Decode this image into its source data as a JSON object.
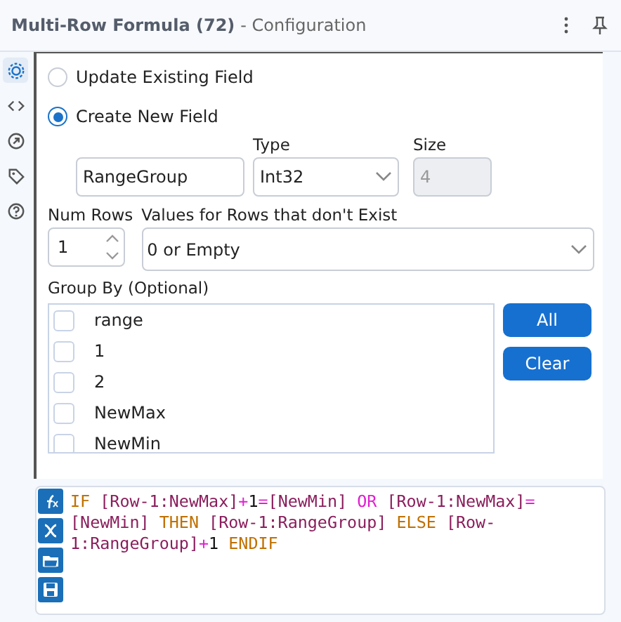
{
  "header": {
    "title": "Multi-Row Formula (72)",
    "subtitle": "- Configuration"
  },
  "side_tabs": [
    {
      "kind": "gear",
      "selected": true
    },
    {
      "kind": "code",
      "selected": false
    },
    {
      "kind": "arrow",
      "selected": false
    },
    {
      "kind": "tag",
      "selected": false
    },
    {
      "kind": "help",
      "selected": false
    }
  ],
  "mode_options": [
    {
      "label": "Update Existing Field",
      "selected": false
    },
    {
      "label": "Create New  Field",
      "selected": true
    }
  ],
  "new_field": {
    "name_value": "RangeGroup",
    "type_label": "Type",
    "type_value": "Int32",
    "size_label": "Size",
    "size_value": "4"
  },
  "num_rows": {
    "label": "Num Rows",
    "value": "1"
  },
  "missing_values": {
    "label": "Values for Rows that don't Exist",
    "value": "0 or Empty"
  },
  "group_by": {
    "label": "Group By (Optional)",
    "items": [
      {
        "label": "range",
        "checked": false
      },
      {
        "label": "1",
        "checked": false
      },
      {
        "label": "2",
        "checked": false
      },
      {
        "label": "NewMax",
        "checked": false
      },
      {
        "label": "NewMin",
        "checked": false
      }
    ],
    "buttons": [
      "All",
      "Clear"
    ]
  },
  "formula": [
    {
      "text": "IF ",
      "kind": "keyword"
    },
    {
      "text": "[Row-1:NewMax]",
      "kind": "field"
    },
    {
      "text": "+",
      "kind": "operator"
    },
    {
      "text": "1",
      "kind": "number"
    },
    {
      "text": "=",
      "kind": "operator"
    },
    {
      "text": "[NewMin]",
      "kind": "field"
    },
    {
      "text": " OR ",
      "kind": "operator"
    },
    {
      "text": "[Row-1:NewMax]",
      "kind": "field"
    },
    {
      "text": "=",
      "kind": "operator"
    },
    {
      "text": "[NewMin]",
      "kind": "field"
    },
    {
      "text": " THEN ",
      "kind": "keyword"
    },
    {
      "text": "[Row-1:RangeGroup]",
      "kind": "field"
    },
    {
      "text": " ELSE ",
      "kind": "keyword"
    },
    {
      "text": "[Row-1:RangeGroup]",
      "kind": "field"
    },
    {
      "text": "+",
      "kind": "operator"
    },
    {
      "text": "1",
      "kind": "number"
    },
    {
      "text": " ENDIF",
      "kind": "keyword"
    }
  ]
}
